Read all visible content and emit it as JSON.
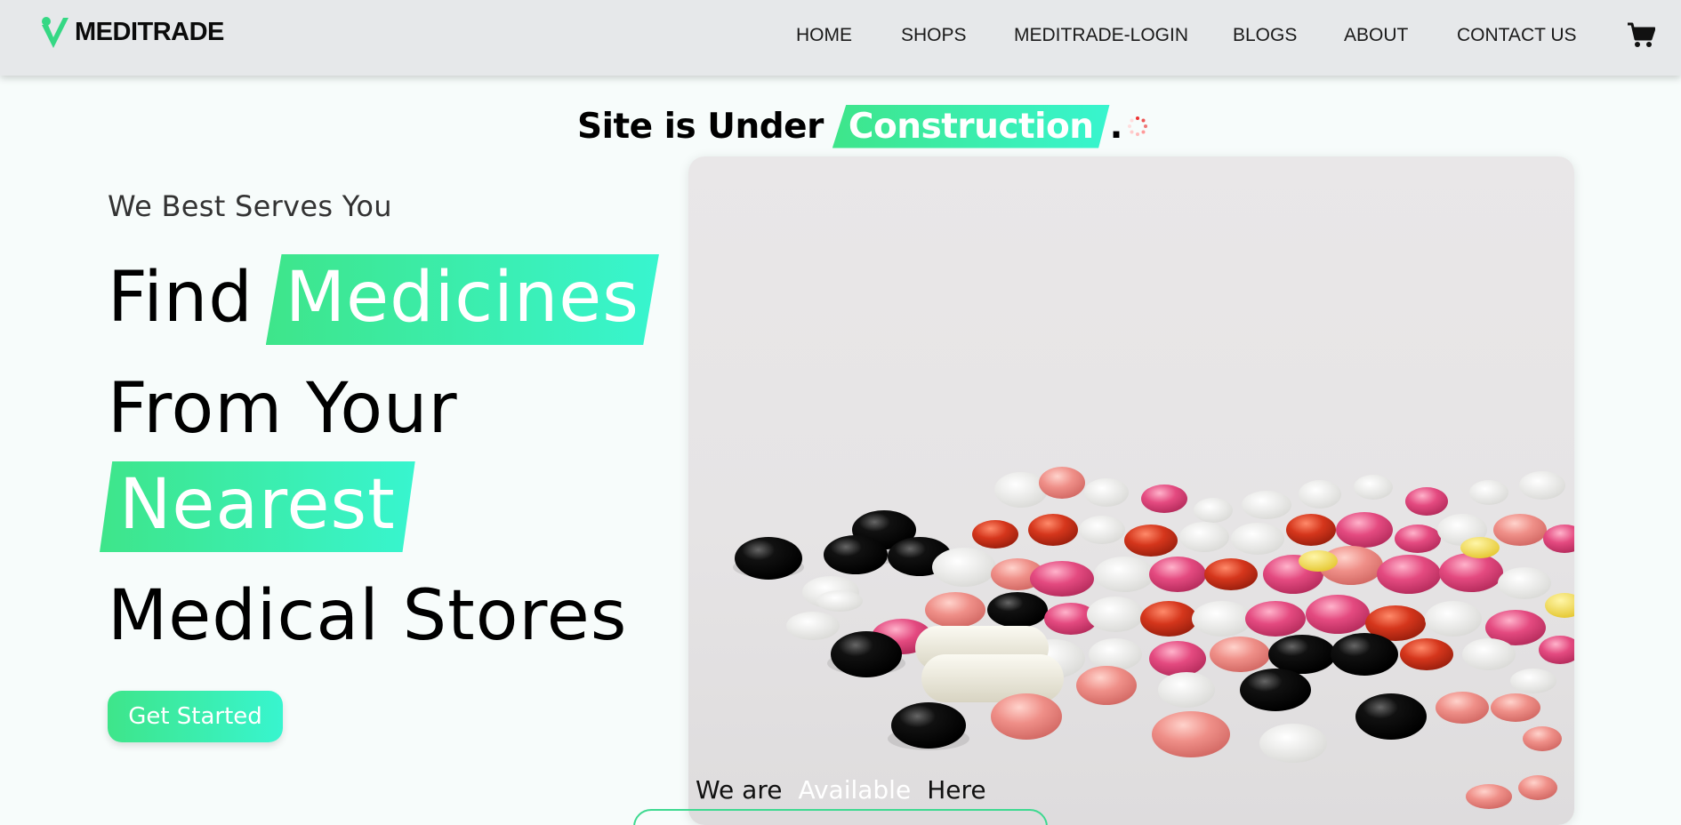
{
  "brand": {
    "name": "MEDITRADE",
    "logo_icon": "check-v-logo-icon",
    "accent": "#3ee58a"
  },
  "nav": {
    "items": [
      {
        "label": "HOME"
      },
      {
        "label": "SHOPS"
      },
      {
        "label": "MEDITRADE-LOGIN"
      },
      {
        "label": "BLOGS"
      },
      {
        "label": "ABOUT"
      },
      {
        "label": "CONTACT US"
      }
    ],
    "cart_icon": "shopping-cart-icon"
  },
  "banner": {
    "prefix": "Site is Under",
    "highlight": "Construction",
    "suffix": ".",
    "spinner_icon": "loading-spinner-icon"
  },
  "hero": {
    "tagline": "We Best Serves You",
    "line1_word": "Find",
    "line1_highlight": "Medicines",
    "line2": "From Your",
    "line3_highlight": "Nearest",
    "line4": "Medical Stores",
    "cta_label": "Get Started",
    "gradient": [
      "#3ee58a",
      "#38f5cf"
    ]
  },
  "available": {
    "pre": "We are",
    "mid": "Available",
    "post": "Here"
  }
}
